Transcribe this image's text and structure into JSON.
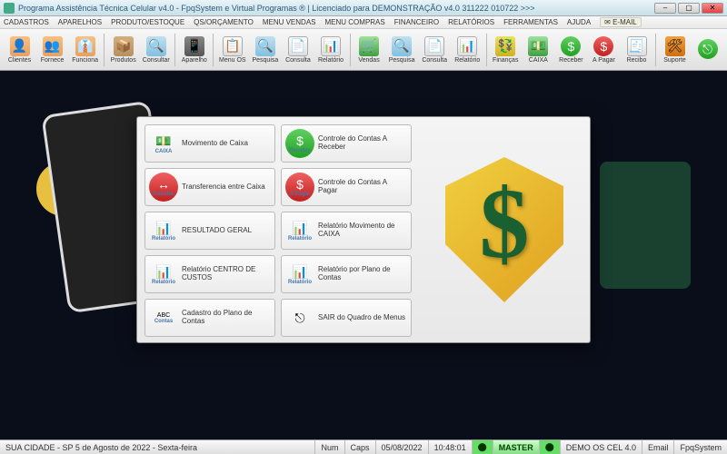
{
  "title": "Programa Assistência Técnica Celular v4.0 - FpqSystem e Virtual Programas ® | Licenciado para  DEMONSTRAÇÃO v4.0 311222 010722 >>>",
  "menubar": [
    "CADASTROS",
    "APARELHOS",
    "PRODUTO/ESTOQUE",
    "QS/ORÇAMENTO",
    "MENU VENDAS",
    "MENU COMPRAS",
    "FINANCEIRO",
    "RELATÓRIOS",
    "FERRAMENTAS",
    "AJUDA"
  ],
  "email_label": "E-MAIL",
  "toolbar": [
    {
      "label": "Clientes",
      "icon": "ic-person",
      "glyph": "👤"
    },
    {
      "label": "Fornece",
      "icon": "ic-person",
      "glyph": "👥"
    },
    {
      "label": "Funciona",
      "icon": "ic-person",
      "glyph": "👔"
    },
    {
      "sep": true
    },
    {
      "label": "Produtos",
      "icon": "ic-box",
      "glyph": "📦"
    },
    {
      "label": "Consultar",
      "icon": "ic-search",
      "glyph": "🔍"
    },
    {
      "sep": true
    },
    {
      "label": "Aparelho",
      "icon": "ic-phone",
      "glyph": "📱"
    },
    {
      "sep": true
    },
    {
      "label": "Menu OS",
      "icon": "ic-doc",
      "glyph": "📋"
    },
    {
      "label": "Pesquisa",
      "icon": "ic-search",
      "glyph": "🔍"
    },
    {
      "label": "Consulta",
      "icon": "ic-doc",
      "glyph": "📄"
    },
    {
      "label": "Relatório",
      "icon": "ic-doc",
      "glyph": "📊"
    },
    {
      "sep": true
    },
    {
      "label": "Vendas",
      "icon": "ic-money",
      "glyph": "🛒"
    },
    {
      "label": "Pesquisa",
      "icon": "ic-search",
      "glyph": "🔍"
    },
    {
      "label": "Consulta",
      "icon": "ic-doc",
      "glyph": "📄"
    },
    {
      "label": "Relatório",
      "icon": "ic-doc",
      "glyph": "📊"
    },
    {
      "sep": true
    },
    {
      "label": "Finanças",
      "icon": "ic-yellow",
      "glyph": "💱"
    },
    {
      "label": "CAIXA",
      "icon": "ic-money",
      "glyph": "💵"
    },
    {
      "label": "Receber",
      "icon": "ic-green",
      "glyph": "$"
    },
    {
      "label": "A Pagar",
      "icon": "ic-red",
      "glyph": "$"
    },
    {
      "label": "Recibo",
      "icon": "ic-doc",
      "glyph": "🧾"
    },
    {
      "sep": true
    },
    {
      "label": "Suporte",
      "icon": "ic-orange",
      "glyph": "🛠"
    },
    {
      "label": "",
      "icon": "ic-green",
      "glyph": "⎋"
    }
  ],
  "modal": {
    "buttons": [
      {
        "label": "Movimento de Caixa",
        "sub": "CAIXA",
        "glyph": "💵"
      },
      {
        "label": "Controle do Contas A Receber",
        "sub": "Receber",
        "glyph": "$",
        "cls": "ic-green"
      },
      {
        "label": "Transferencia entre Caixa",
        "sub": "Transfer.",
        "glyph": "↔",
        "cls": "ic-red"
      },
      {
        "label": "Controle do Contas A Pagar",
        "sub": "A Pagar",
        "glyph": "$",
        "cls": "ic-red"
      },
      {
        "label": "RESULTADO GERAL",
        "sub": "Relatório",
        "glyph": "📊"
      },
      {
        "label": "Relatório Movimento de CAIXA",
        "sub": "Relatório",
        "glyph": "📊"
      },
      {
        "label": "Relatório CENTRO DE CUSTOS",
        "sub": "Relatório",
        "glyph": "📊"
      },
      {
        "label": "Relatório por Plano de Contas",
        "sub": "Relatório",
        "glyph": "📊"
      },
      {
        "label": "Cadastro do Plano de Contas",
        "sub": "Contas",
        "glyph": "ABC"
      },
      {
        "label": "SAIR do Quadro de Menus",
        "sub": "",
        "glyph": "⎋"
      }
    ]
  },
  "status": {
    "left": "SUA CIDADE - SP  5 de Agosto de 2022 - Sexta-feira",
    "num": "Num",
    "caps": "Caps",
    "date": "05/08/2022",
    "time": "10:48:01",
    "master": "MASTER",
    "demo": "DEMO OS CEL 4.0",
    "email": "Email",
    "brand": "FpqSystem"
  }
}
